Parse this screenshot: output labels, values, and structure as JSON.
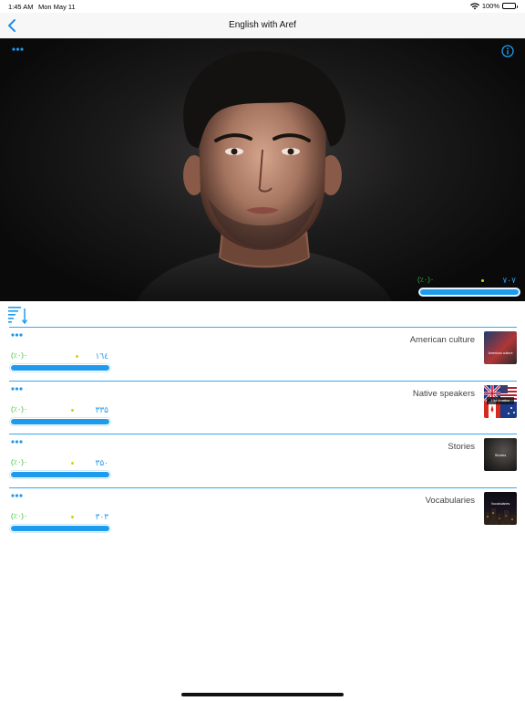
{
  "status_bar": {
    "time": "1:45 AM",
    "date": "Mon May 11",
    "battery": "100%"
  },
  "nav": {
    "title": "English with Aref"
  },
  "hero": {
    "progress": {
      "percent_label": "(٪۰)۰",
      "count": "۷۰۷",
      "fraction": 1.0
    }
  },
  "list": {
    "items": [
      {
        "title": "American culture",
        "percent_label": "(٪۰)۰",
        "count": "۱٦٤",
        "fraction": 1.0,
        "thumb_caption": "American culture"
      },
      {
        "title": "Native speakers",
        "percent_label": "(٪۰)۰",
        "count": "۳۳۵",
        "fraction": 1.0,
        "thumb_caption": "Like a native"
      },
      {
        "title": "Stories",
        "percent_label": "(٪۰)۰",
        "count": "۳۵۰",
        "fraction": 1.0,
        "thumb_caption": "Stories"
      },
      {
        "title": "Vocabularies",
        "percent_label": "(٪۰)۰",
        "count": "۳۰۳",
        "fraction": 1.0,
        "thumb_caption": "Vocabularies"
      }
    ]
  },
  "colors": {
    "accent": "#1f9bee",
    "percent": "#2dbd2d",
    "divider": "#3aa8ef"
  },
  "icons": [
    "back-chevron-icon",
    "more-dots-icon",
    "info-icon",
    "sort-icon",
    "wifi-icon",
    "battery-icon"
  ]
}
